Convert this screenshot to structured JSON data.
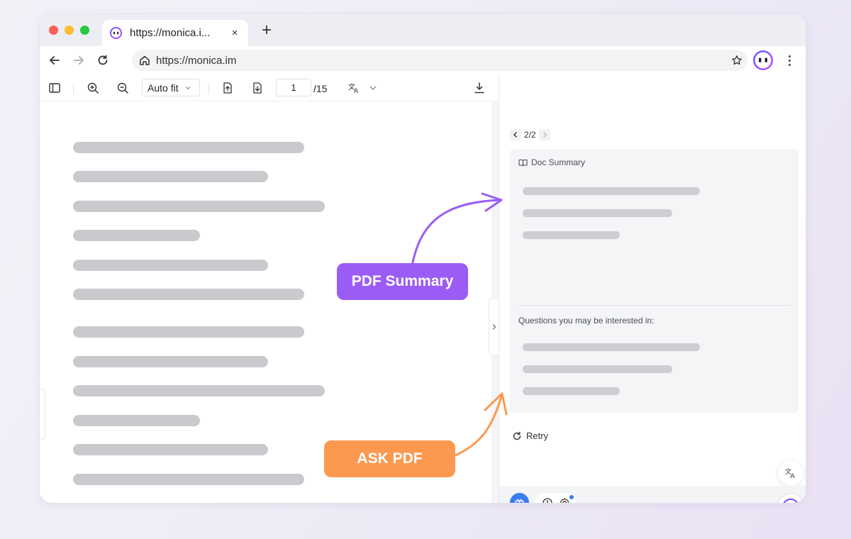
{
  "browser": {
    "tab_title": "https://monica.i...",
    "tab_close": "×",
    "new_tab": "+",
    "url": "https://monica.im"
  },
  "pdf_toolbar": {
    "zoom_mode": "Auto fit",
    "current_page": "1",
    "total_pages": "/15"
  },
  "panel": {
    "pager": "2/2",
    "card_title": "Doc Summary",
    "questions_label": "Questions you may be interested in:",
    "retry_label": "Retry"
  },
  "annotations": {
    "summary_label": "PDF Summary",
    "ask_label": "ASK PDF"
  },
  "colors": {
    "accent_purple": "#9b5cf6",
    "accent_orange": "#fc9950",
    "accent_blue": "#3d7cf0",
    "skeleton_gray": "#c9cacd"
  }
}
